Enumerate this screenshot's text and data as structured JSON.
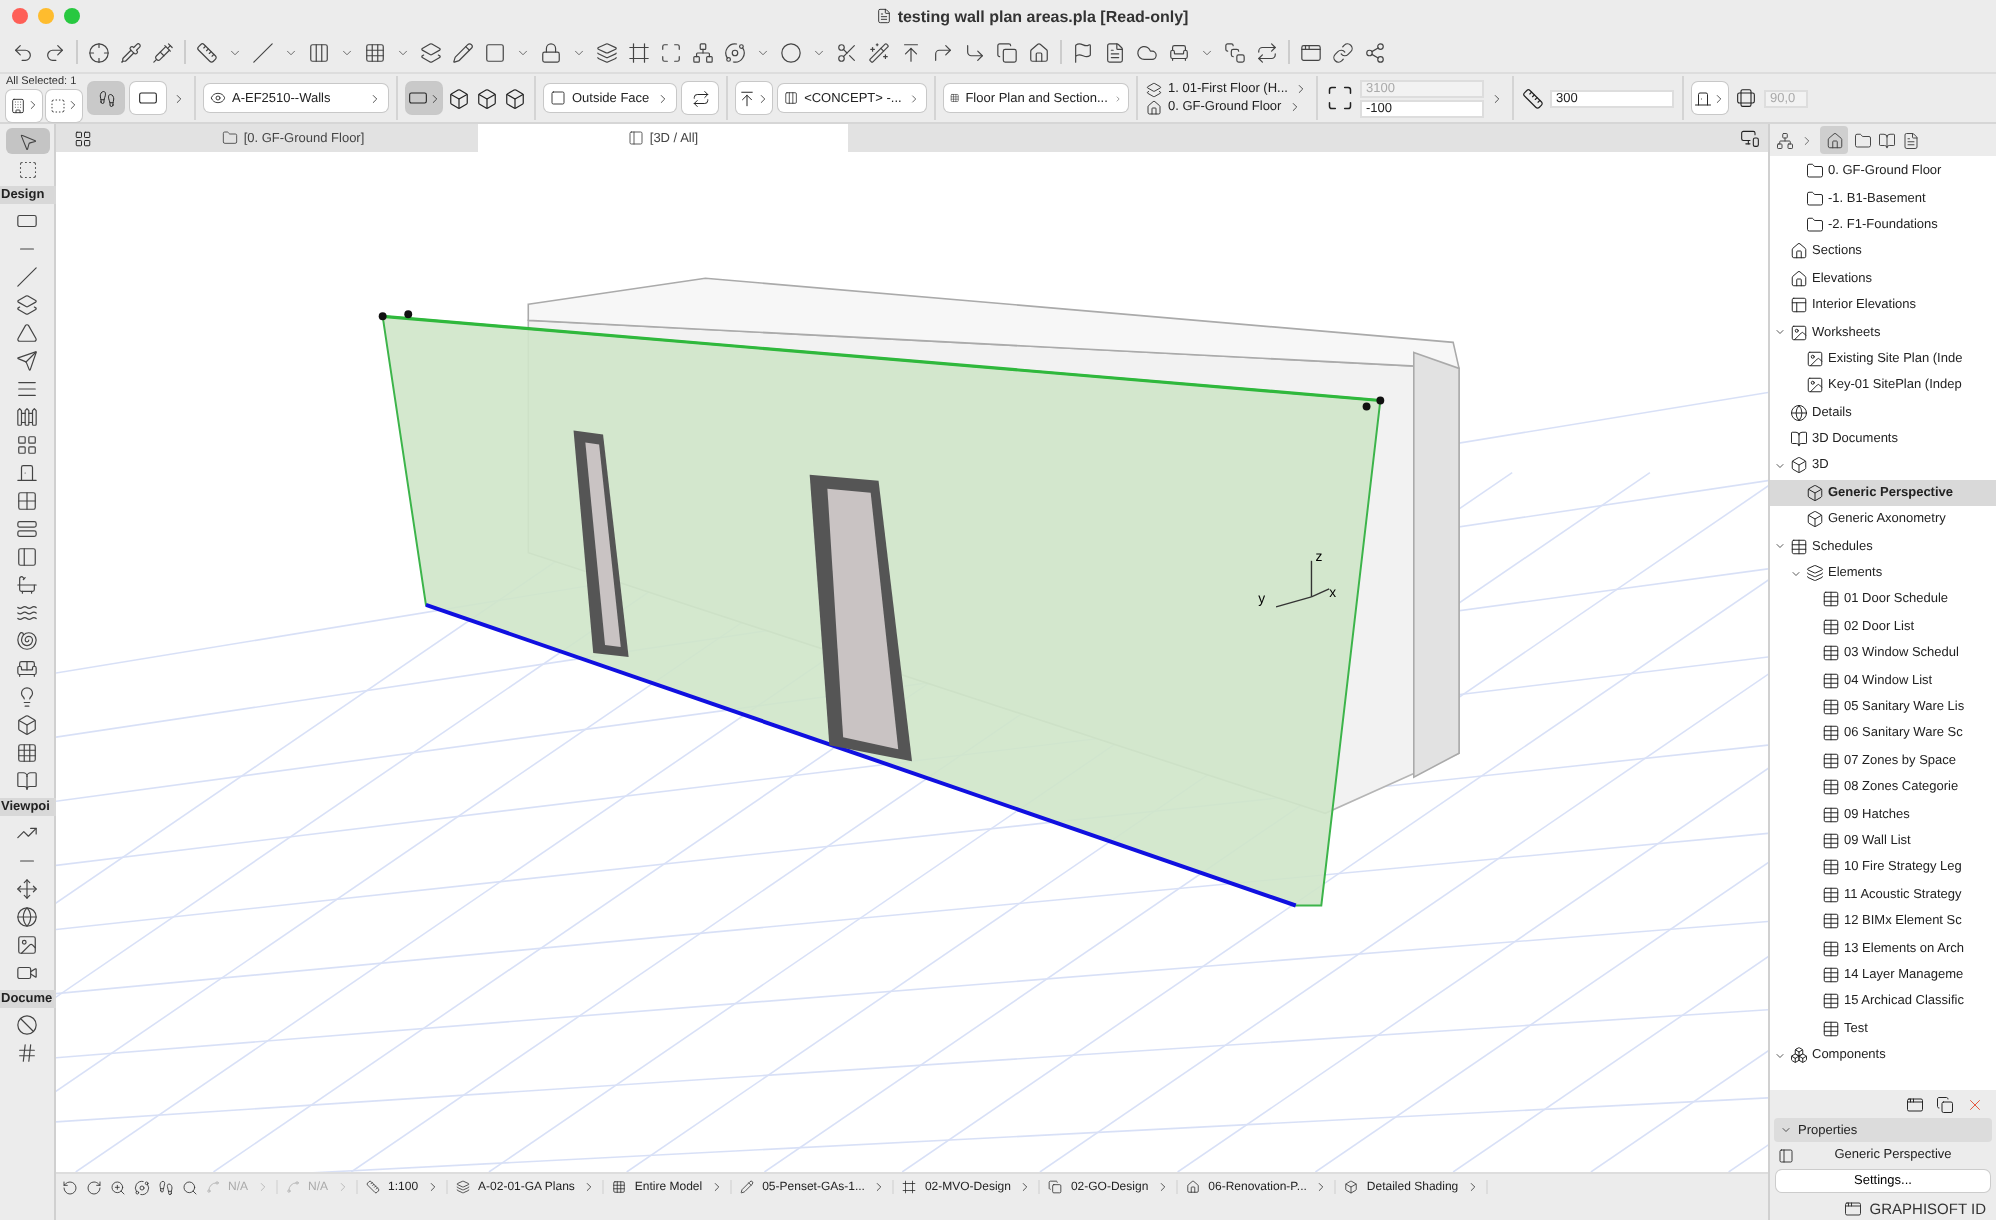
{
  "window": {
    "title": "testing wall plan areas.pla [Read-only]"
  },
  "info_box": {
    "selection": "All Selected: 1",
    "layer": "A-EF2510--Walls",
    "reference_line": "Outside Face",
    "composite": "<CONCEPT> -...",
    "floor_plan_display": "Floor Plan and Section...",
    "top_story": "1. 01-First Floor (H...",
    "home_story": "0. GF-Ground Floor",
    "height": {
      "value": "3100",
      "disabled": true
    },
    "offset": {
      "value": "-100",
      "disabled": false
    },
    "thickness": {
      "value": "300",
      "disabled": false
    },
    "angle": {
      "value": "90,0",
      "disabled": true
    }
  },
  "tabs": [
    {
      "label": "[0. GF-Ground Floor]",
      "selected": false
    },
    {
      "label": "[3D / All]",
      "selected": true
    }
  ],
  "toolbox": {
    "arrow_tool": {
      "selected": true
    },
    "sections": [
      {
        "label": "Design"
      },
      {
        "label": "Viewpoi"
      },
      {
        "label": "Docume"
      }
    ]
  },
  "viewport": {
    "axis_labels": [
      "z",
      "y",
      "x"
    ]
  },
  "navigator": {
    "tree": [
      {
        "children": [
          {
            "label": "0. GF-Ground Floor",
            "kind": "story",
            "selected": false
          },
          {
            "label": "-1. B1-Basement",
            "kind": "story",
            "selected": false
          },
          {
            "label": "-2. F1-Foundations",
            "kind": "story",
            "selected": false
          }
        ]
      },
      {
        "label": "Sections",
        "kind": "section",
        "selected": false
      },
      {
        "label": "Elevations",
        "kind": "section",
        "selected": false
      },
      {
        "label": "Interior Elevations",
        "kind": "interior",
        "selected": false
      },
      {
        "label": "Worksheets",
        "kind": "worksheet",
        "selected": false,
        "expanded": true,
        "children": [
          {
            "label": "Existing Site Plan (Inde",
            "kind": "worksheet",
            "selected": false
          },
          {
            "label": "Key-01 SitePlan (Indep",
            "kind": "worksheet",
            "selected": false
          }
        ]
      },
      {
        "label": "Details",
        "kind": "detail",
        "selected": false
      },
      {
        "label": "3D Documents",
        "kind": "doc3d",
        "selected": false
      },
      {
        "label": "3D",
        "kind": "view3d",
        "selected": false,
        "expanded": true,
        "children": [
          {
            "label": "Generic Perspective",
            "kind": "view3d",
            "selected": true
          },
          {
            "label": "Generic Axonometry",
            "kind": "view3d",
            "selected": false
          }
        ]
      },
      {
        "label": "Schedules",
        "kind": "schedule",
        "selected": false,
        "expanded": true,
        "children": [
          {
            "label": "Elements",
            "kind": "elements",
            "selected": false,
            "expanded": true,
            "children": [
              {
                "label": "01 Door Schedule",
                "kind": "schedule",
                "selected": false
              },
              {
                "label": "02 Door List",
                "kind": "schedule",
                "selected": false
              },
              {
                "label": "03 Window Schedul",
                "kind": "schedule",
                "selected": false
              },
              {
                "label": "04 Window List",
                "kind": "schedule",
                "selected": false
              },
              {
                "label": "05 Sanitary Ware Lis",
                "kind": "schedule",
                "selected": false
              },
              {
                "label": "06 Sanitary Ware Sc",
                "kind": "schedule",
                "selected": false
              },
              {
                "label": "07 Zones by Space",
                "kind": "schedule",
                "selected": false
              },
              {
                "label": "08 Zones Categorie",
                "kind": "schedule",
                "selected": false
              },
              {
                "label": "09 Hatches",
                "kind": "schedule",
                "selected": false
              },
              {
                "label": "09 Wall List",
                "kind": "schedule",
                "selected": false
              },
              {
                "label": "10 Fire Strategy Leg",
                "kind": "schedule",
                "selected": false
              },
              {
                "label": "11 Acoustic Strategy",
                "kind": "schedule",
                "selected": false
              },
              {
                "label": "12 BIMx Element Sc",
                "kind": "schedule",
                "selected": false
              },
              {
                "label": "13 Elements on Arch",
                "kind": "schedule",
                "selected": false
              },
              {
                "label": "14 Layer Manageme",
                "kind": "schedule",
                "selected": false
              },
              {
                "label": "15 Archicad Classific",
                "kind": "schedule",
                "selected": false
              },
              {
                "label": "Test",
                "kind": "schedule",
                "selected": false
              }
            ]
          }
        ]
      },
      {
        "label": "Components",
        "kind": "components",
        "selected": false,
        "expanded": true
      }
    ]
  },
  "properties": {
    "title": "Properties",
    "expanded": true,
    "view_name": "Generic Perspective",
    "settings_button": "Settings..."
  },
  "status_bar": {
    "items": [
      {
        "label": "N/A",
        "disabled": true
      },
      {
        "label": "N/A",
        "disabled": true
      },
      {
        "label": "1:100",
        "disabled": false
      },
      {
        "label": "A-02-01-GA Plans",
        "disabled": false
      },
      {
        "label": "Entire Model",
        "disabled": false
      },
      {
        "label": "05-Penset-GAs-1...",
        "disabled": false
      },
      {
        "label": "02-MVO-Design",
        "disabled": false
      },
      {
        "label": "02-GO-Design",
        "disabled": false
      },
      {
        "label": "06-Renovation-P...",
        "disabled": false
      },
      {
        "label": "Detailed Shading",
        "disabled": false
      }
    ]
  },
  "footer": {
    "id_label": "GRAPHISOFT ID"
  }
}
